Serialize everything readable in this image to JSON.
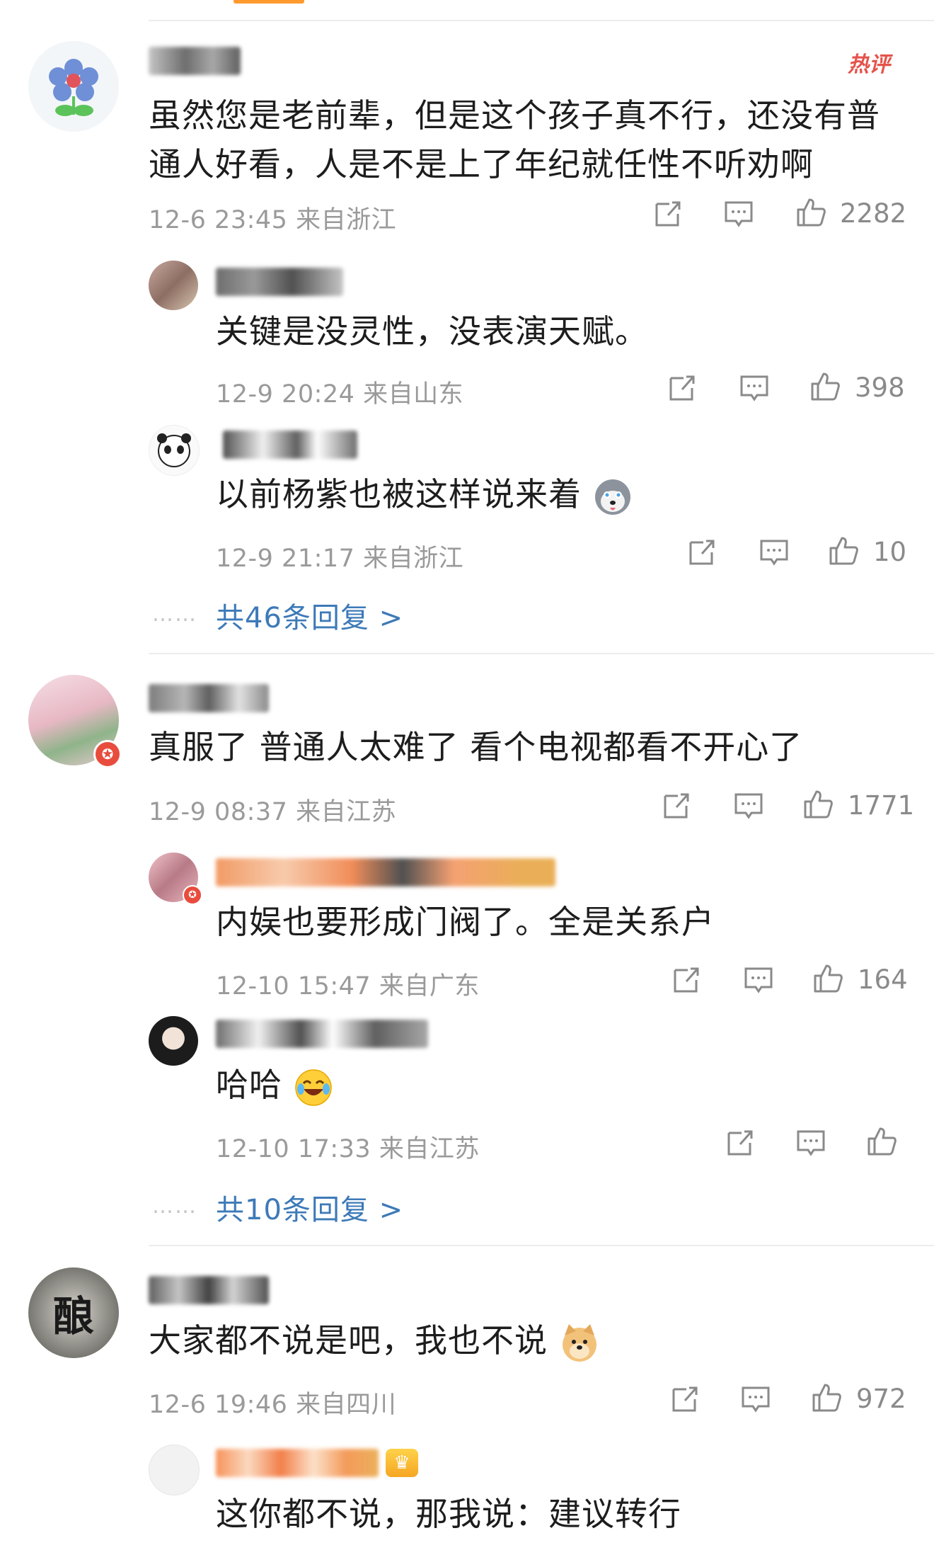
{
  "comments": [
    {
      "badge": "热评",
      "text_lines": [
        "虽然您是老前辈，但是这个孩子真不行，还没有普",
        "通人好看，人是不是上了年纪就任性不听劝啊"
      ],
      "time": "12-6 23:45",
      "location": "来自浙江",
      "likes": "2282",
      "replies": [
        {
          "text": "关键是没灵性，没表演天赋。",
          "time": "12-9 20:24",
          "location": "来自山东",
          "likes": "398"
        },
        {
          "text": "以前杨紫也被这样说来着",
          "time": "12-9 21:17",
          "location": "来自浙江",
          "likes": "10"
        }
      ],
      "more_replies": "共46条回复 >"
    },
    {
      "text_lines": [
        "真服了  普通人太难了  看个电视都看不开心了"
      ],
      "time": "12-9 08:37",
      "location": "来自江苏",
      "likes": "1771",
      "replies": [
        {
          "text": "内娱也要形成门阀了。全是关系户",
          "time": "12-10 15:47",
          "location": "来自广东",
          "likes": "164"
        },
        {
          "text": "哈哈",
          "time": "12-10 17:33",
          "location": "来自江苏",
          "likes": ""
        }
      ],
      "more_replies": "共10条回复 >"
    },
    {
      "text_lines": [
        "大家都不说是吧，我也不说"
      ],
      "time": "12-6 19:46",
      "location": "来自四川",
      "likes": "972",
      "replies": [
        {
          "text": "这你都不说，那我说：建议转行"
        }
      ]
    }
  ],
  "colors": {
    "link": "#3d7ab8",
    "meta": "#9a9a9a",
    "hot": "#e5534b"
  },
  "dots": "……",
  "avatar_label": "酿"
}
